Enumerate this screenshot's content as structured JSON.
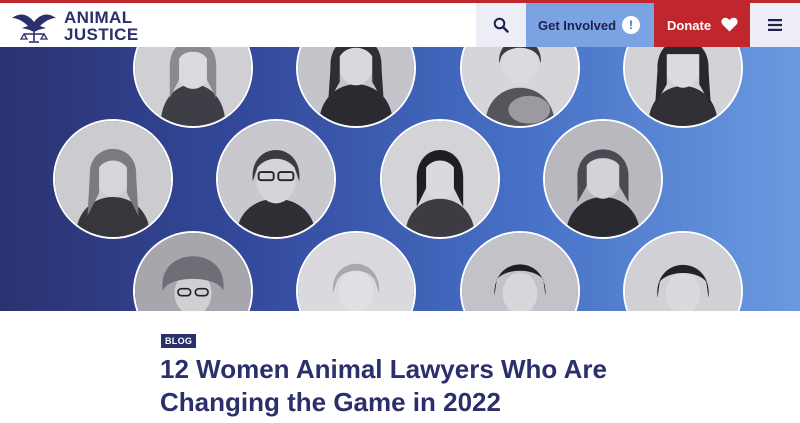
{
  "header": {
    "logo_line1": "ANIMAL",
    "logo_line2": "JUSTICE",
    "logo_icon": "dove-scales-icon",
    "search_icon": "search-icon",
    "get_involved_label": "Get Involved",
    "get_involved_icon": "exclamation-bubble-icon",
    "donate_label": "Donate",
    "donate_icon": "heart-icon",
    "menu_icon": "hamburger-menu-icon"
  },
  "colors": {
    "brand_navy": "#2b2f6b",
    "brand_red": "#c0272d",
    "accent_blue": "#7ba3e3",
    "light_grey": "#ecedf5"
  },
  "article": {
    "category": "BLOG",
    "title": "12 Women Animal Lawyers Who Are Changing the Game in 2022"
  }
}
